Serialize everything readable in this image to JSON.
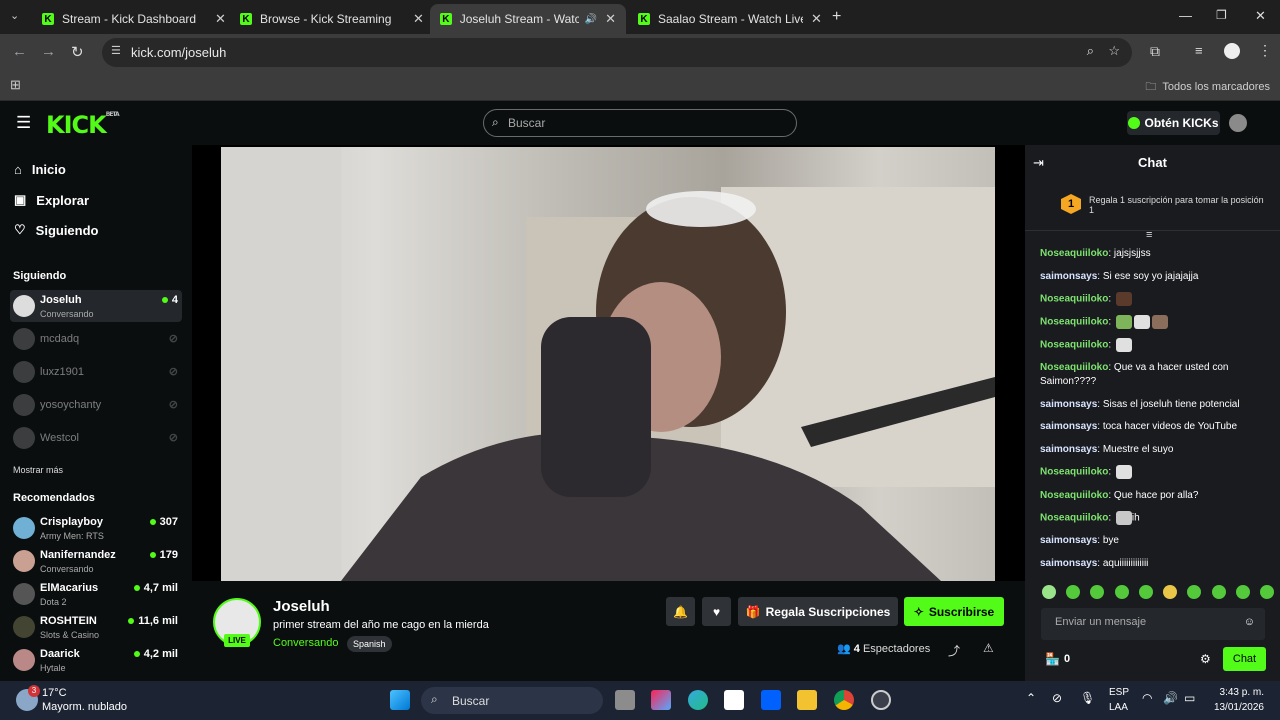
{
  "browser": {
    "tabs": [
      {
        "title": "Stream - Kick Dashboard"
      },
      {
        "title": "Browse - Kick Streaming"
      },
      {
        "title": "Joseluh Stream - Watch Live"
      },
      {
        "title": "Saalao Stream - Watch Live on"
      }
    ],
    "url": "kick.com/joseluh",
    "bookmarks_label": "Todos los marcadores"
  },
  "header": {
    "logo": "KICK",
    "logo_badge": "BETA",
    "search_placeholder": "Buscar",
    "kicks_button": "Obtén KICKs"
  },
  "sidebar": {
    "nav": [
      {
        "label": "Inicio",
        "icon": "home-icon"
      },
      {
        "label": "Explorar",
        "icon": "compass-icon"
      },
      {
        "label": "Siguiendo",
        "icon": "heart-icon"
      }
    ],
    "following_title": "Siguiendo",
    "following": [
      {
        "name": "Joseluh",
        "sub": "Conversando",
        "count": "4",
        "live": true
      },
      {
        "name": "mcdadq",
        "live": false
      },
      {
        "name": "luxz1901",
        "live": false
      },
      {
        "name": "yosoychanty",
        "live": false
      },
      {
        "name": "Westcol",
        "live": false
      }
    ],
    "show_more": "Mostrar más",
    "recommended_title": "Recomendados",
    "recommended": [
      {
        "name": "Crisplayboy",
        "sub": "Army Men: RTS",
        "count": "307"
      },
      {
        "name": "Nanifernandez",
        "sub": "Conversando",
        "count": "179"
      },
      {
        "name": "ElMacarius",
        "sub": "Dota 2",
        "count": "4,7 mil"
      },
      {
        "name": "ROSHTEIN",
        "sub": "Slots & Casino",
        "count": "11,6 mil"
      },
      {
        "name": "Daarick",
        "sub": "Hytale",
        "count": "4,2 mil"
      }
    ]
  },
  "stream": {
    "name": "Joseluh",
    "live_badge": "LIVE",
    "title": "primer stream del año me cago en la mierda",
    "category": "Conversando",
    "language": "Spanish",
    "gift_button": "Regala Suscripciones",
    "subscribe_button": "Suscribirse",
    "viewers_count": "4",
    "viewers_label": "Espectadores"
  },
  "chat": {
    "title": "Chat",
    "gift_rank": "1",
    "gift_text": "Regala 1 suscripción para tomar la posición 1",
    "messages": [
      {
        "user": "Noseaquiiloko",
        "text": "jajsjsjjss",
        "color": "green"
      },
      {
        "user": "saimonsays",
        "text": "Si ese soy yo jajajajja",
        "color": "white"
      },
      {
        "user": "Noseaquiiloko",
        "text": "",
        "color": "green",
        "emotes": 1
      },
      {
        "user": "Noseaquiiloko",
        "text": "",
        "color": "green",
        "emotes": 3
      },
      {
        "user": "Noseaquiiloko",
        "text": "",
        "color": "green",
        "emotes": 1
      },
      {
        "user": "Noseaquiiloko",
        "text": "Que va a hacer usted con Saimon????",
        "color": "green"
      },
      {
        "user": "saimonsays",
        "text": "Sisas el joseluh tiene potencial",
        "color": "white"
      },
      {
        "user": "saimonsays",
        "text": "toca hacer videos de YouTube",
        "color": "white"
      },
      {
        "user": "saimonsays",
        "text": "Muestre el suyo",
        "color": "white"
      },
      {
        "user": "Noseaquiiloko",
        "text": "",
        "color": "green",
        "emotes": 1
      },
      {
        "user": "Noseaquiiloko",
        "text": "Que hace por alla?",
        "color": "green"
      },
      {
        "user": "Noseaquiiloko",
        "text": "ih",
        "color": "green",
        "emotes": 1
      },
      {
        "user": "saimonsays",
        "text": "bye",
        "color": "white"
      },
      {
        "user": "saimonsays",
        "text": "aquiiiiiiiiiiiii",
        "color": "white"
      }
    ],
    "input_placeholder": "Enviar un mensaje",
    "kicks_count": "0",
    "send_button": "Chat"
  },
  "taskbar": {
    "temperature": "17°C",
    "weather": "Mayorm. nublado",
    "search_label": "Buscar",
    "lang_top": "ESP",
    "lang_bottom": "LAA",
    "time": "3:43 p. m.",
    "date": "13/01/2026",
    "weather_badge": "3"
  },
  "colors": {
    "accent": "#53fc18",
    "bg": "#0b0e0f",
    "chat_bg": "#191b1f"
  }
}
